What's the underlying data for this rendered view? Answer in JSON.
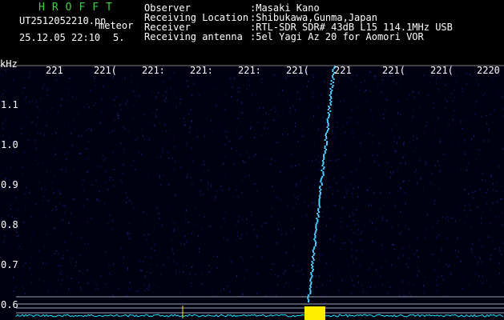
{
  "app": {
    "name": "HROFFT"
  },
  "file": {
    "name": "UT2512052210.pn",
    "type_label": "meteor",
    "datetime": "25.12.05 22:10",
    "frame": "5."
  },
  "station": {
    "labels": [
      "Observer",
      "Receiving Location",
      "Receiver",
      "Receiving antenna"
    ],
    "values": [
      ":Masaki Kano",
      ":Shibukawa,Gunma,Japan",
      ":RTL-SDR SDR# 43dB L15 114.1MHz USB",
      ":5el Yagi Az 20 for Aomori VOR"
    ]
  },
  "chart_data": {
    "type": "heatmap",
    "ylabel": "kHz",
    "y_ticks": [
      "1.1",
      "1.0",
      "0.9",
      "0.8",
      "0.7",
      "0.6"
    ],
    "x_ticks": [
      "221",
      "221(",
      "221:",
      "221:",
      "221:",
      "221(",
      "221",
      "221(",
      "221(",
      "2220"
    ],
    "baseline": 0.6,
    "colors": {
      "background": "#000010",
      "noise": "#1a2a9a",
      "signal": "#4fd0ff",
      "spectrum": "#19e3ff",
      "burst": "#ffee00"
    }
  }
}
